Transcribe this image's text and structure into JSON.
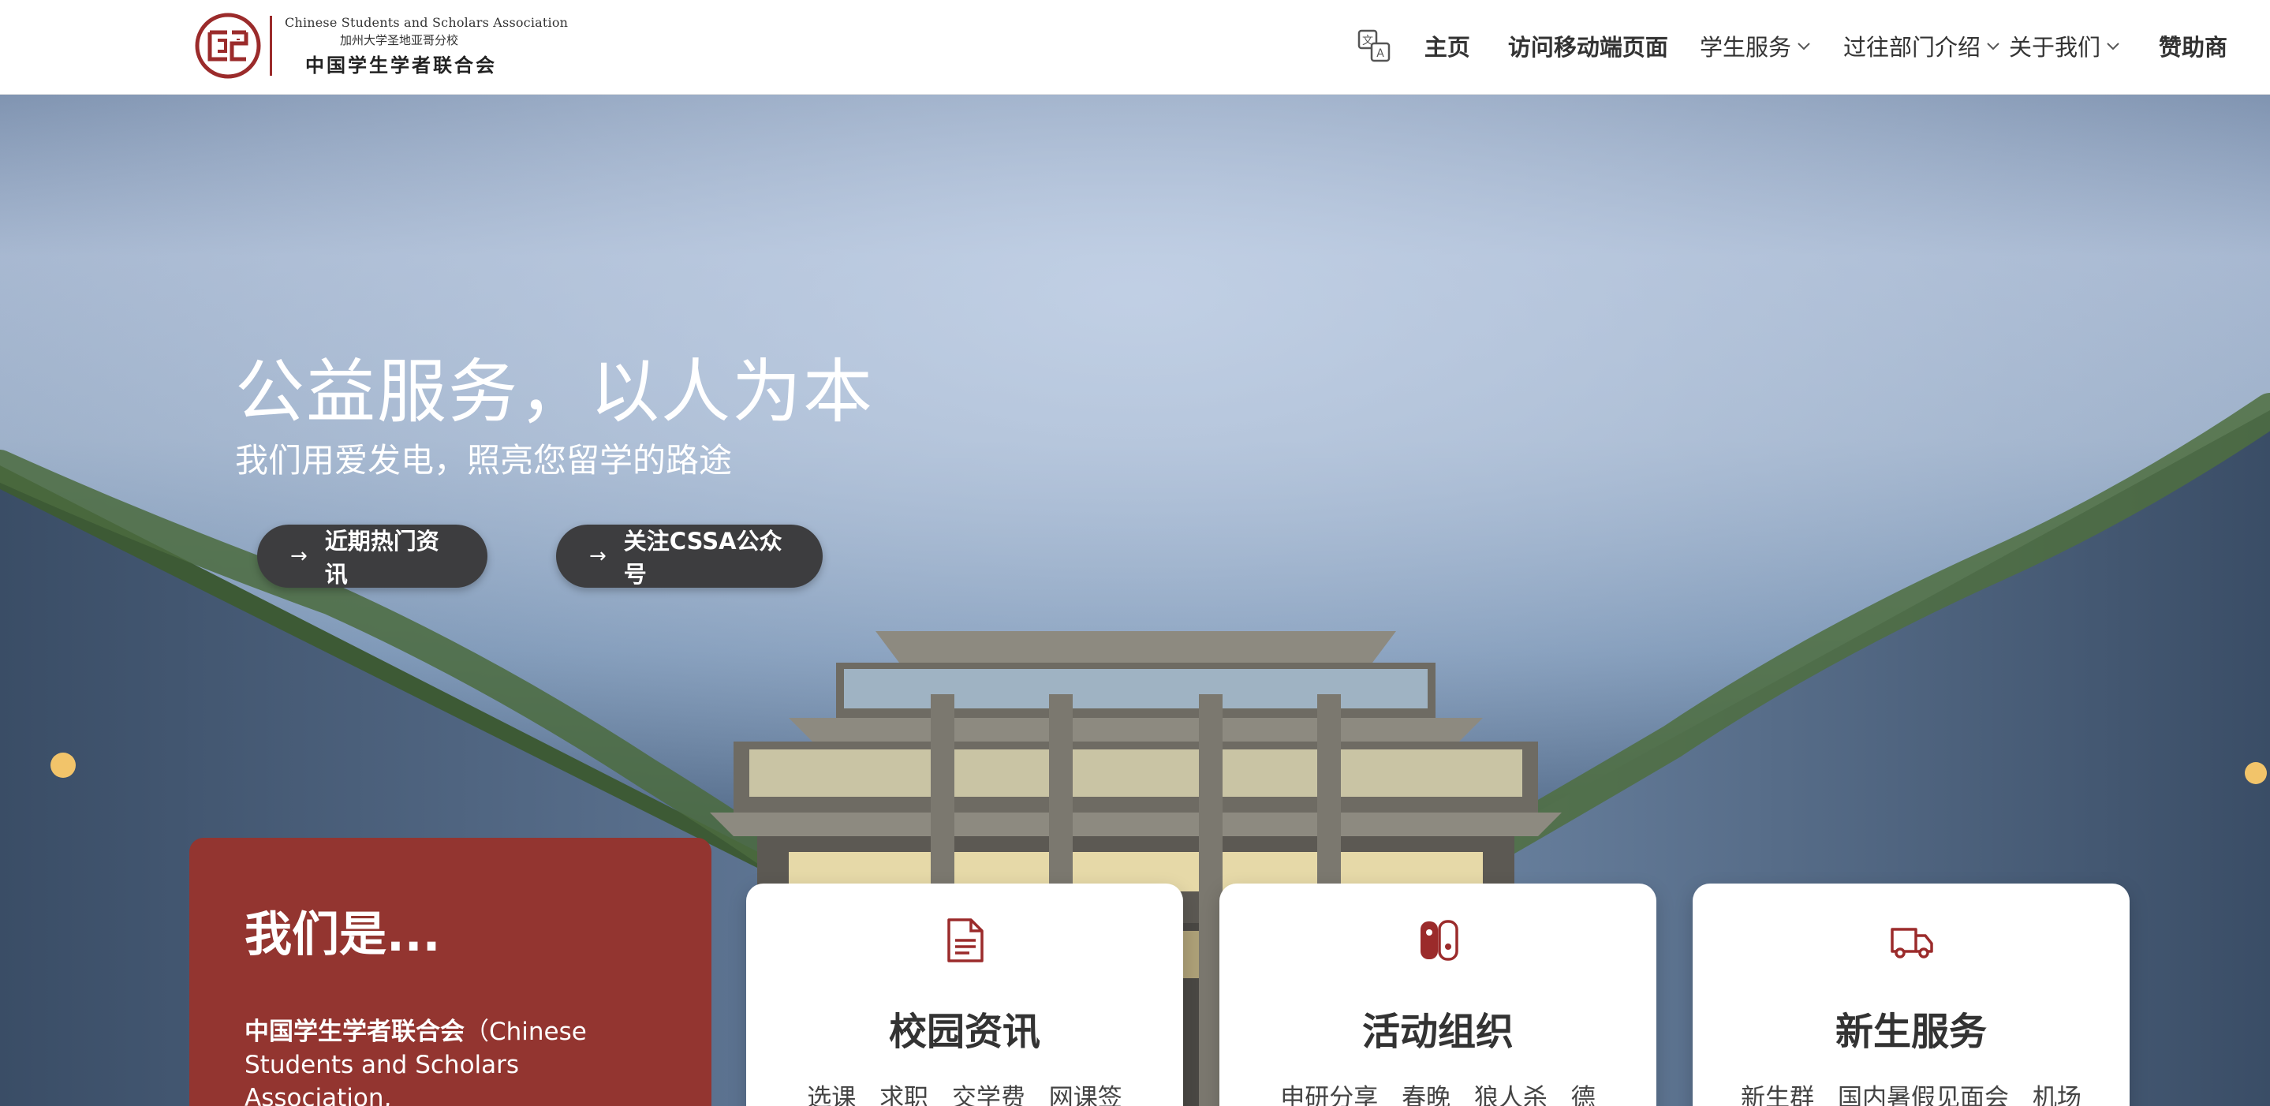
{
  "header": {
    "logo": {
      "en": "Chinese Students and Scholars Association",
      "cn_small": "加州大学圣地亚哥分校",
      "cn": "中国学生学者联合会"
    },
    "nav": {
      "translate_icon": "translate-icon",
      "items": [
        {
          "label": "主页"
        },
        {
          "label": "访问移动端页面"
        },
        {
          "label": "学生服务",
          "dropdown": true
        },
        {
          "label": "过往部门介绍",
          "dropdown": true
        },
        {
          "label": "关于我们",
          "dropdown": true
        },
        {
          "label": "赞助商"
        }
      ]
    }
  },
  "hero": {
    "title": "公益服务，以人为本",
    "subtitle": "我们用爱发电，照亮您留学的路途",
    "buttons": [
      {
        "label": "近期热门资讯",
        "icon": "arrow-right-icon"
      },
      {
        "label": "关注CSSA公众号",
        "icon": "arrow-right-icon"
      }
    ]
  },
  "about": {
    "title": "我们是...",
    "body_bold": "中国学生学者联合会",
    "body_rest": "（Chinese Students and Scholars Association,"
  },
  "services": [
    {
      "title": "校园资讯",
      "icon": "document-icon",
      "tags": [
        "选课",
        "求职",
        "交学费",
        "网课签"
      ]
    },
    {
      "title": "活动组织",
      "icon": "game-controller-icon",
      "tags": [
        "申研分享",
        "春晚",
        "狼人杀",
        "德"
      ]
    },
    {
      "title": "新生服务",
      "icon": "truck-icon",
      "tags": [
        "新生群",
        "国内暑假见面会",
        "机场"
      ]
    }
  ],
  "colors": {
    "brand_red": "#933530",
    "button_dark": "#3d3d3f",
    "icon_red": "#9b2b2b"
  }
}
